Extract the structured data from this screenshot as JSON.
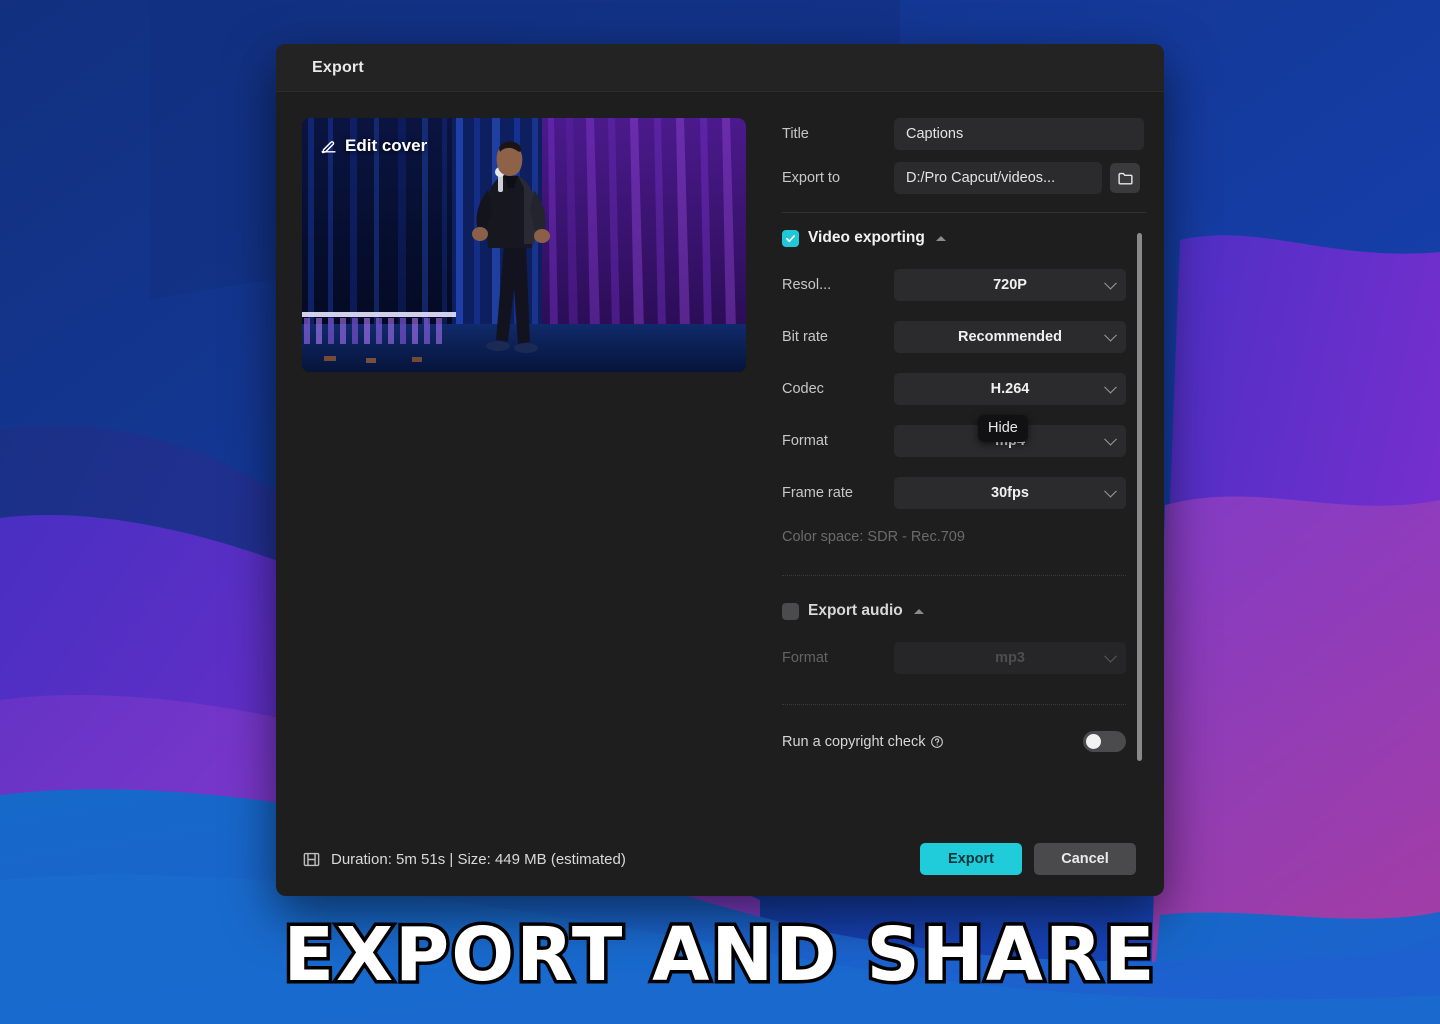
{
  "window": {
    "title": "Export"
  },
  "cover": {
    "edit_label": "Edit cover",
    "edit_icon": "pencil-icon"
  },
  "form": {
    "title_label": "Title",
    "title_value": "Captions",
    "export_to_label": "Export to",
    "export_to_value": "D:/Pro Capcut/videos...",
    "folder_icon": "folder-icon"
  },
  "video_section": {
    "heading": "Video exporting",
    "checked": true,
    "collapse_icon": "chevron-up-icon",
    "fields": [
      {
        "label": "Resol...",
        "value": "720P"
      },
      {
        "label": "Bit rate",
        "value": "Recommended"
      },
      {
        "label": "Codec",
        "value": "H.264"
      },
      {
        "label": "Format",
        "value": "mp4"
      },
      {
        "label": "Frame rate",
        "value": "30fps"
      }
    ],
    "color_space": "Color space: SDR - Rec.709"
  },
  "audio_section": {
    "heading": "Export audio",
    "checked": false,
    "collapse_icon": "chevron-up-icon",
    "format_label": "Format",
    "format_value": "mp3"
  },
  "tooltip": {
    "text": "Hide"
  },
  "copyright": {
    "label": "Run a copyright check",
    "info_icon": "info-circle-icon",
    "toggle_on": false
  },
  "footer": {
    "film_icon": "film-strip-icon",
    "status": "Duration: 5m 51s | Size: 449 MB (estimated)",
    "export_label": "Export",
    "cancel_label": "Cancel"
  },
  "overlay_caption": {
    "text": "EXPORT AND SHARE"
  },
  "colors": {
    "accent": "#20cbda",
    "dialog_bg": "#1e1e1e",
    "titlebar_bg": "#232323",
    "field_bg": "#2b2b2d",
    "wallpaper_blue": "#1438a0",
    "wallpaper_purple": "#7b2fd0"
  }
}
